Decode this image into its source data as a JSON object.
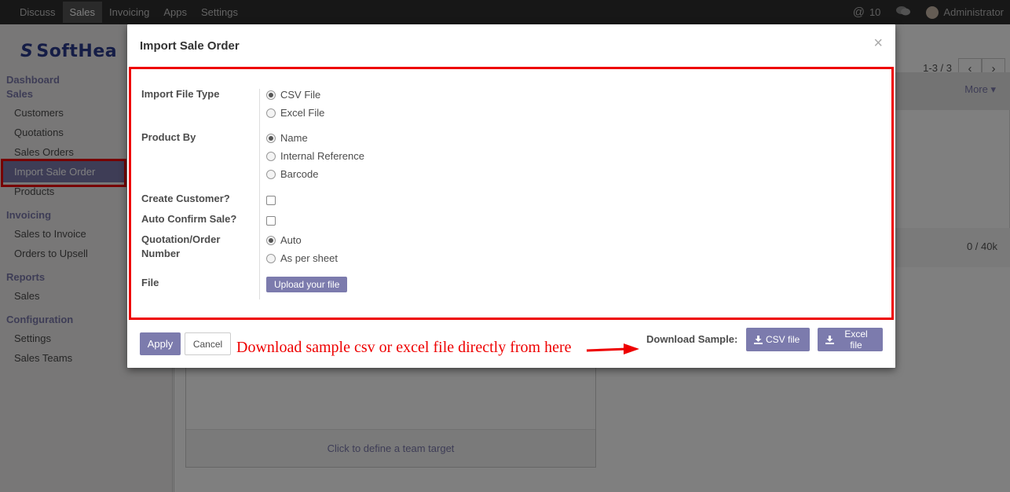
{
  "topbar": {
    "menu": [
      "Discuss",
      "Sales",
      "Invoicing",
      "Apps",
      "Settings"
    ],
    "active_menu": "Sales",
    "notifications_count": "10",
    "user_name": "Administrator"
  },
  "logo_text": "SoftHea",
  "sidebar": {
    "sections": [
      {
        "title": "Dashboard"
      },
      {
        "title": "Sales",
        "items": [
          "Customers",
          "Quotations",
          "Sales Orders",
          "Import Sale Order",
          "Products"
        ]
      },
      {
        "title": "Invoicing",
        "items": [
          "Sales to Invoice",
          "Orders to Upsell"
        ]
      },
      {
        "title": "Reports",
        "items": [
          "Sales"
        ]
      },
      {
        "title": "Configuration",
        "items": [
          "Settings",
          "Sales Teams"
        ]
      }
    ],
    "active_item": "Import Sale Order"
  },
  "main": {
    "pager": "1-3 / 3",
    "pager_prev": "‹",
    "pager_next": "›",
    "more_label": "More",
    "progress_text": "0 / 40k",
    "team_target_label": "Click to define a team target"
  },
  "modal": {
    "title": "Import Sale Order",
    "close": "×",
    "fields": {
      "file_type": {
        "label": "Import File Type",
        "options": [
          "CSV File",
          "Excel File"
        ],
        "selected": "CSV File"
      },
      "product_by": {
        "label": "Product By",
        "options": [
          "Name",
          "Internal Reference",
          "Barcode"
        ],
        "selected": "Name"
      },
      "create_customer": {
        "label": "Create Customer?",
        "checked": false
      },
      "auto_confirm": {
        "label": "Auto Confirm Sale?",
        "checked": false
      },
      "order_number": {
        "label_line1": "Quotation/Order",
        "label_line2": "Number",
        "options": [
          "Auto",
          "As per sheet"
        ],
        "selected": "Auto"
      },
      "file": {
        "label": "File",
        "button": "Upload your file"
      }
    },
    "footer": {
      "apply": "Apply",
      "cancel": "Cancel",
      "annotation": "Download sample csv or excel file directly from here",
      "download_label": "Download Sample:",
      "csv_button": "CSV file",
      "excel_button": "Excel file"
    }
  },
  "colors": {
    "accent": "#7c7bad",
    "highlight_red": "#e00000",
    "topbar_bg": "#2f2f2f"
  }
}
